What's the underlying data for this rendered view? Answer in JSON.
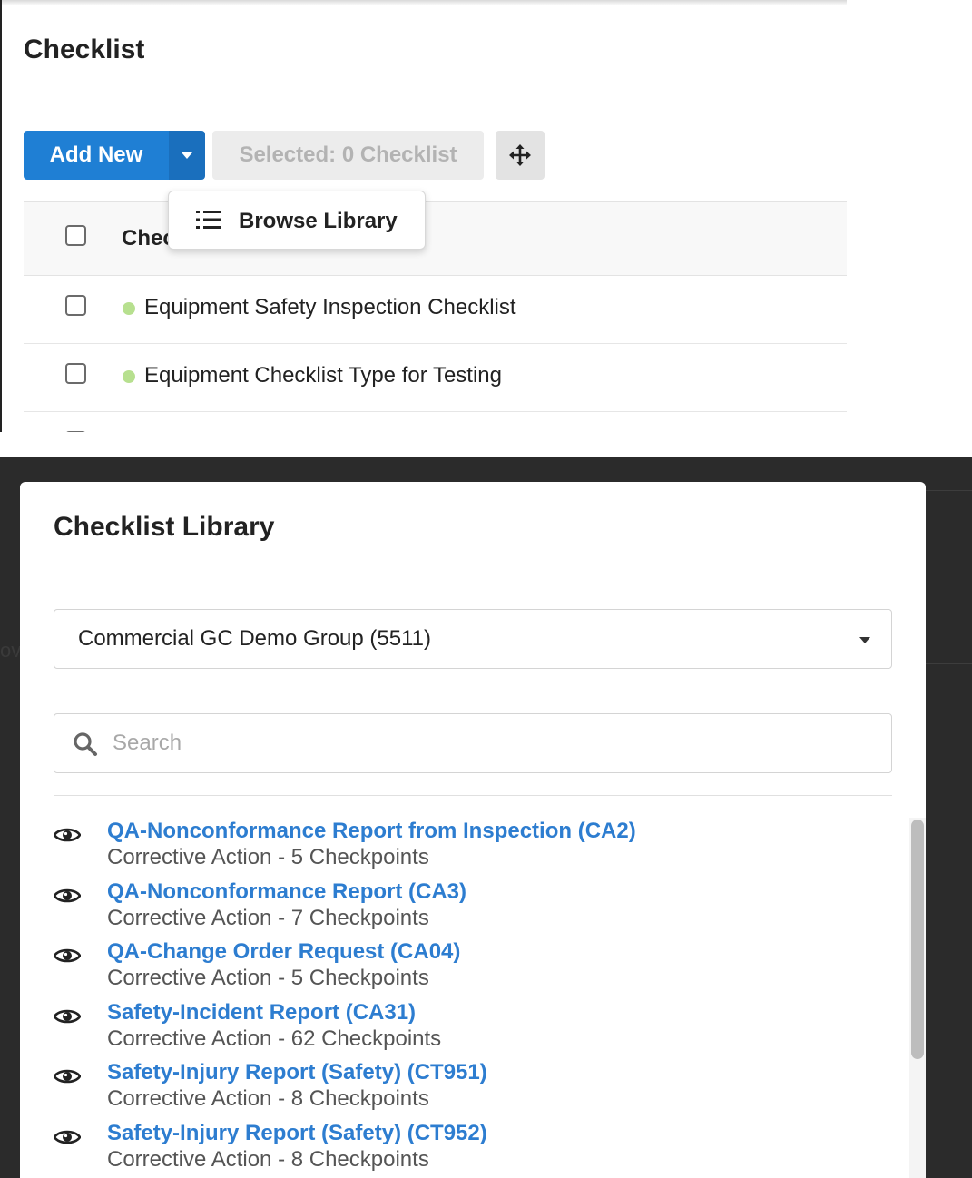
{
  "checklist_page": {
    "title": "Checklist",
    "add_new_label": "Add New",
    "selected_label": "Selected: 0 Checklist",
    "column_header": "Chec",
    "dropdown": {
      "browse_library_label": "Browse Library"
    },
    "rows": [
      {
        "label": "Equipment Safety Inspection Checklist",
        "status_color": "#b7e08f"
      },
      {
        "label": "Equipment Checklist Type for Testing",
        "status_color": "#b7e08f"
      }
    ],
    "accent_color": "#1f7fd4"
  },
  "library_modal": {
    "title": "Checklist Library",
    "group_select": {
      "value": "Commercial GC Demo Group (5511)"
    },
    "search": {
      "placeholder": "Search",
      "value": ""
    },
    "background_text": "ov",
    "items": [
      {
        "name": "QA-Nonconformance Report from Inspection (CA2)",
        "meta": "Corrective Action - 5 Checkpoints"
      },
      {
        "name": "QA-Nonconformance Report (CA3)",
        "meta": "Corrective Action - 7 Checkpoints"
      },
      {
        "name": "QA-Change Order Request (CA04)",
        "meta": "Corrective Action - 5 Checkpoints"
      },
      {
        "name": "Safety-Incident Report (CA31)",
        "meta": "Corrective Action - 62 Checkpoints"
      },
      {
        "name": "Safety-Injury Report (Safety) (CT951)",
        "meta": "Corrective Action - 8 Checkpoints"
      },
      {
        "name": "Safety-Injury Report (Safety) (CT952)",
        "meta": "Corrective Action - 8 Checkpoints"
      }
    ],
    "link_color": "#2d7dd0"
  }
}
